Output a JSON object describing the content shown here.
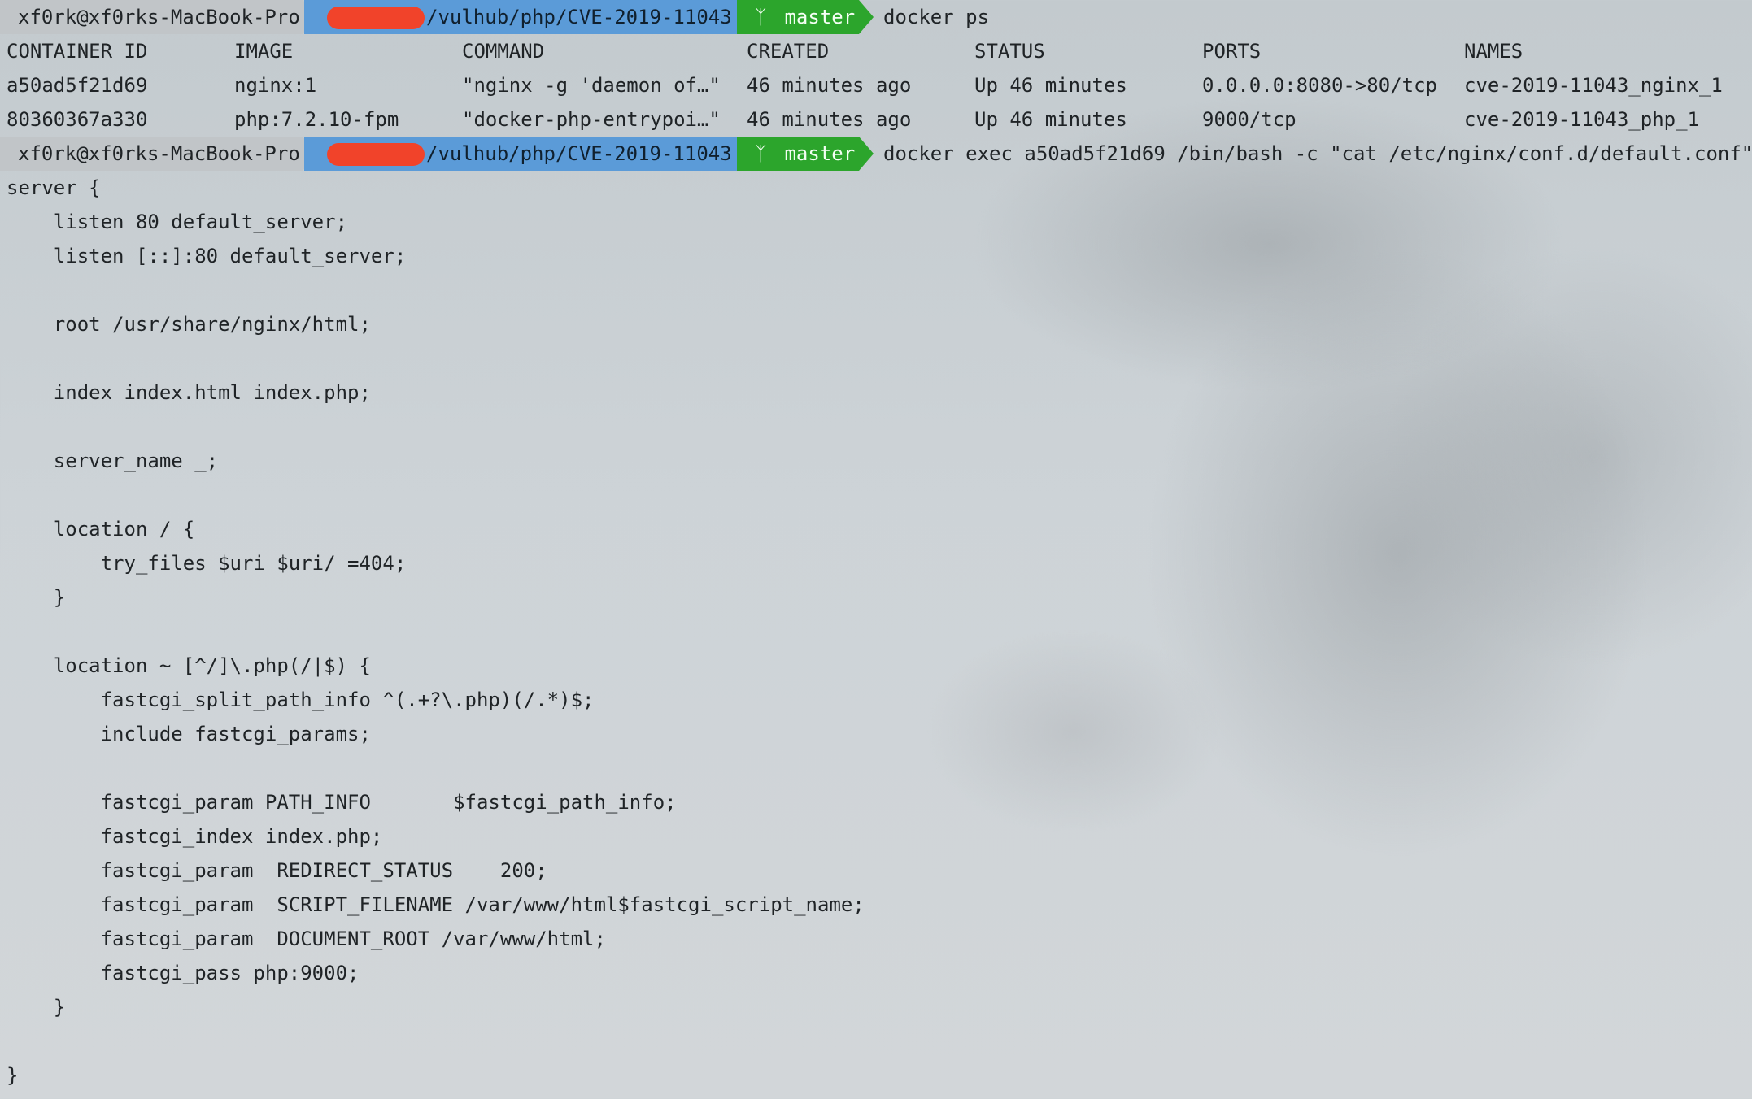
{
  "prompt": {
    "user_host": "xf0rk@xf0rks-MacBook-Pro",
    "path": "/vulhub/php/CVE-2019-11043",
    "branch": "master"
  },
  "commands": {
    "first": "docker ps",
    "second": "docker exec a50ad5f21d69 /bin/bash -c \"cat /etc/nginx/conf.d/default.conf\""
  },
  "docker_ps": {
    "headers": [
      "CONTAINER ID",
      "IMAGE",
      "COMMAND",
      "CREATED",
      "STATUS",
      "PORTS",
      "NAMES"
    ],
    "rows": [
      [
        "a50ad5f21d69",
        "nginx:1",
        "\"nginx -g 'daemon of…\"",
        "46 minutes ago",
        "Up 46 minutes",
        "0.0.0.0:8080->80/tcp",
        "cve-2019-11043_nginx_1"
      ],
      [
        "80360367a330",
        "php:7.2.10-fpm",
        "\"docker-php-entrypoi…\"",
        "46 minutes ago",
        "Up 46 minutes",
        "9000/tcp",
        "cve-2019-11043_php_1"
      ]
    ]
  },
  "config_lines": [
    "server {",
    "    listen 80 default_server;",
    "    listen [::]:80 default_server;",
    "",
    "    root /usr/share/nginx/html;",
    "",
    "    index index.html index.php;",
    "",
    "    server_name _;",
    "",
    "    location / {",
    "        try_files $uri $uri/ =404;",
    "    }",
    "",
    "    location ~ [^/]\\.php(/|$) {",
    "        fastcgi_split_path_info ^(.+?\\.php)(/.*)$;",
    "        include fastcgi_params;",
    "",
    "        fastcgi_param PATH_INFO       $fastcgi_path_info;",
    "        fastcgi_index index.php;",
    "        fastcgi_param  REDIRECT_STATUS    200;",
    "        fastcgi_param  SCRIPT_FILENAME /var/www/html$fastcgi_script_name;",
    "        fastcgi_param  DOCUMENT_ROOT /var/www/html;",
    "        fastcgi_pass php:9000;",
    "    }",
    "",
    "}"
  ]
}
